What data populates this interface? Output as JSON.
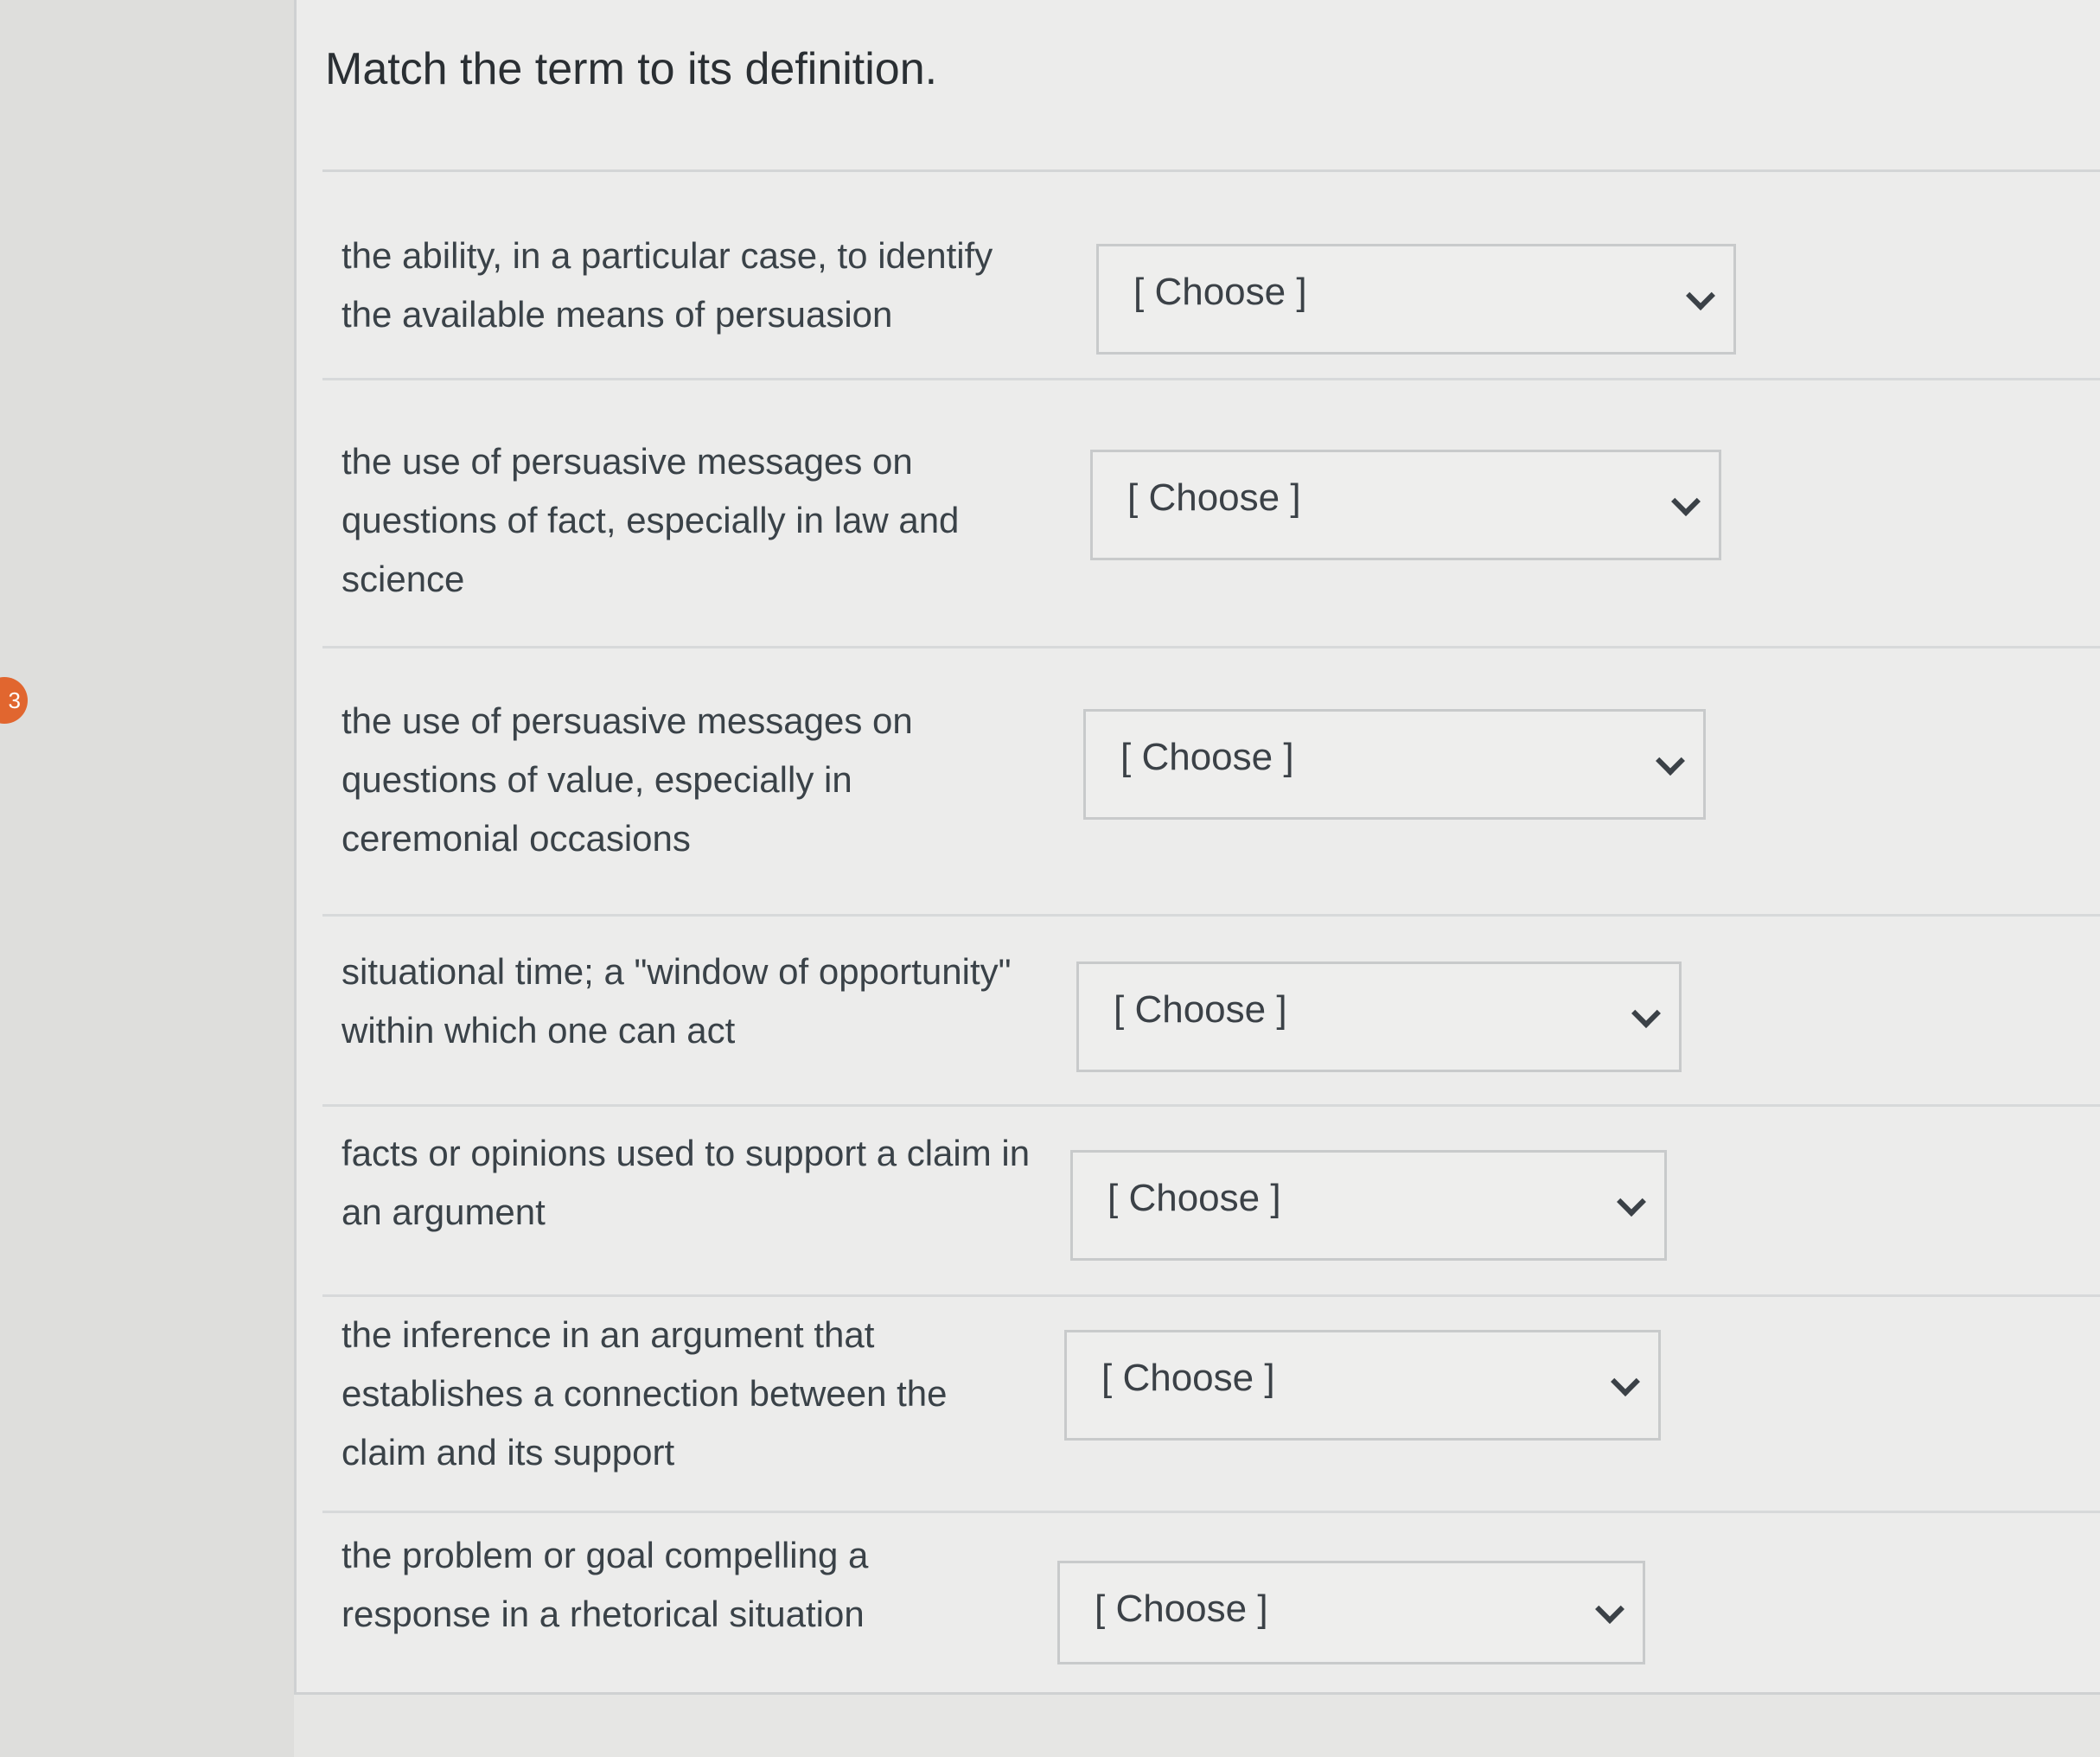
{
  "side_badge": "3",
  "question": {
    "title": "Match the term to its definition."
  },
  "rows": [
    {
      "definition": "the ability, in a particular case, to identify the available means of persuasion",
      "select_label": "[ Choose ]"
    },
    {
      "definition": "the use of persuasive messages on questions of fact, especially in law and science",
      "select_label": "[ Choose ]"
    },
    {
      "definition": "the use of persuasive messages on questions of value, especially in ceremonial occasions",
      "select_label": "[ Choose ]"
    },
    {
      "definition": "situational time; a \"window of opportunity\" within which one can act",
      "select_label": "[ Choose ]"
    },
    {
      "definition": "facts or opinions used to support a claim in an argument",
      "select_label": "[ Choose ]"
    },
    {
      "definition": "the inference in an argument that establishes a connection between the claim and its support",
      "select_label": "[ Choose ]"
    },
    {
      "definition": "the problem or goal compelling a response in a rhetorical situation",
      "select_label": "[ Choose ]"
    }
  ],
  "colors": {
    "badge": "#e1662f",
    "text": "#3a4248",
    "border": "#c8cacb"
  },
  "icons": [
    "chevron-down-icon"
  ]
}
